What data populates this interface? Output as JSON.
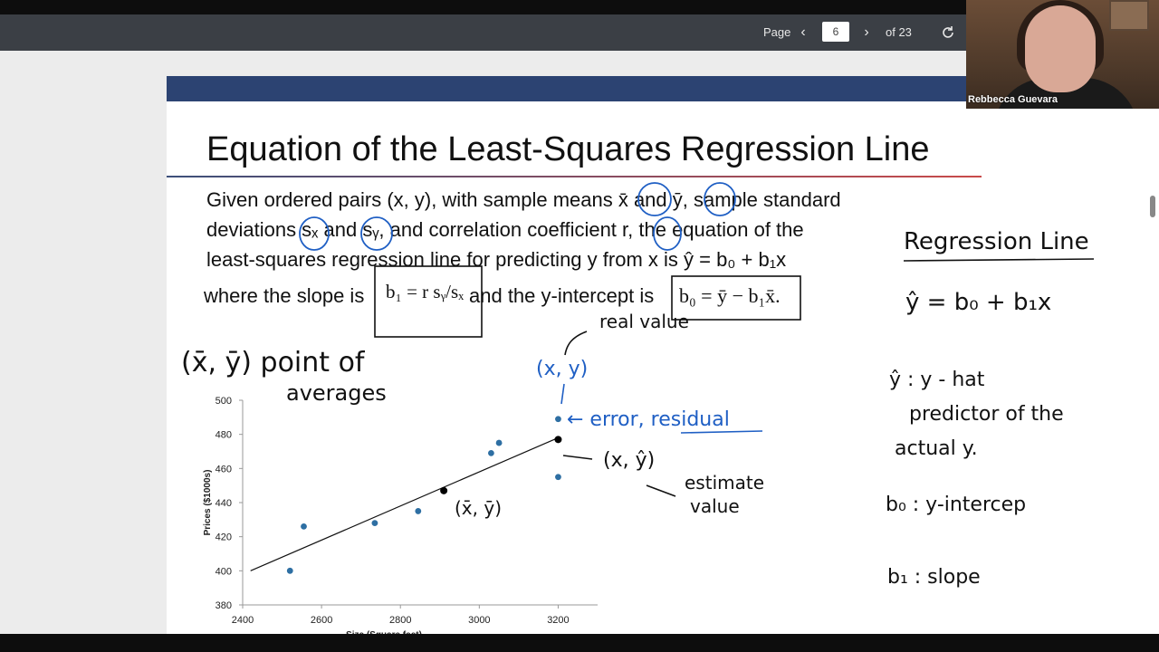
{
  "toolbar": {
    "page_label": "Page",
    "page_value": "6",
    "of_label": "of 23",
    "prev_icon": "chevron-left-icon",
    "next_icon": "chevron-right-icon",
    "refresh_icon": "refresh-icon"
  },
  "webcam": {
    "participant_name": "Rebbecca Guevara"
  },
  "slide": {
    "title": "Equation of the Least-Squares Regression Line",
    "line1": "Given ordered pairs (x, y), with sample means x̄ and ȳ, sample standard",
    "line2": "deviations sₓ and sᵧ, and correlation coefficient r, the equation of the",
    "line3": "least-squares regression line for predicting y from x is ŷ = b₀ + b₁x",
    "line4_a": "where the slope is",
    "formula_slope": "b₁ = r sᵧ/sₓ",
    "line4_b": "and the y-intercept is",
    "formula_intercept": "b₀ = ȳ − b₁x̄."
  },
  "annotations": {
    "point_of_averages_a": "(x̄, ȳ)  point of",
    "point_of_averages_b": "averages",
    "real_value": "real value",
    "xy_blue": "(x, y)",
    "error_residual": "← error, residual",
    "xyhat": "(x, ŷ)",
    "estimate": "estimate",
    "value": "value",
    "xbar_ybar": "(x̄, ȳ)",
    "side_title": "Regression Line",
    "side_eq": "ŷ = b₀ + b₁x",
    "side_yhat": "ŷ : y - hat",
    "side_pred1": "predictor of the",
    "side_pred2": "actual y.",
    "side_b0": "b₀ : y-intercep",
    "side_b1": "b₁ : slope"
  },
  "chart_data": {
    "type": "scatter",
    "xlabel": "Size (Square feet)",
    "ylabel": "Prices ($1000s)",
    "xlim": [
      2400,
      3300
    ],
    "ylim": [
      380,
      500
    ],
    "xticks": [
      "2400",
      "2600",
      "2800",
      "3000",
      "3200"
    ],
    "yticks": [
      "380",
      "400",
      "420",
      "440",
      "460",
      "480",
      "500"
    ],
    "points": [
      {
        "x": 2520,
        "y": 400
      },
      {
        "x": 2555,
        "y": 426
      },
      {
        "x": 2735,
        "y": 428
      },
      {
        "x": 2845,
        "y": 435
      },
      {
        "x": 3030,
        "y": 469
      },
      {
        "x": 3050,
        "y": 475
      },
      {
        "x": 3200,
        "y": 455
      },
      {
        "x": 3200,
        "y": 489
      }
    ],
    "line": [
      {
        "x": 2420,
        "y": 400
      },
      {
        "x": 3200,
        "y": 478
      }
    ],
    "highlight_points": [
      {
        "x": 2910,
        "y": 447
      },
      {
        "x": 3200,
        "y": 477
      }
    ],
    "point_color": "#2e6fa3"
  }
}
